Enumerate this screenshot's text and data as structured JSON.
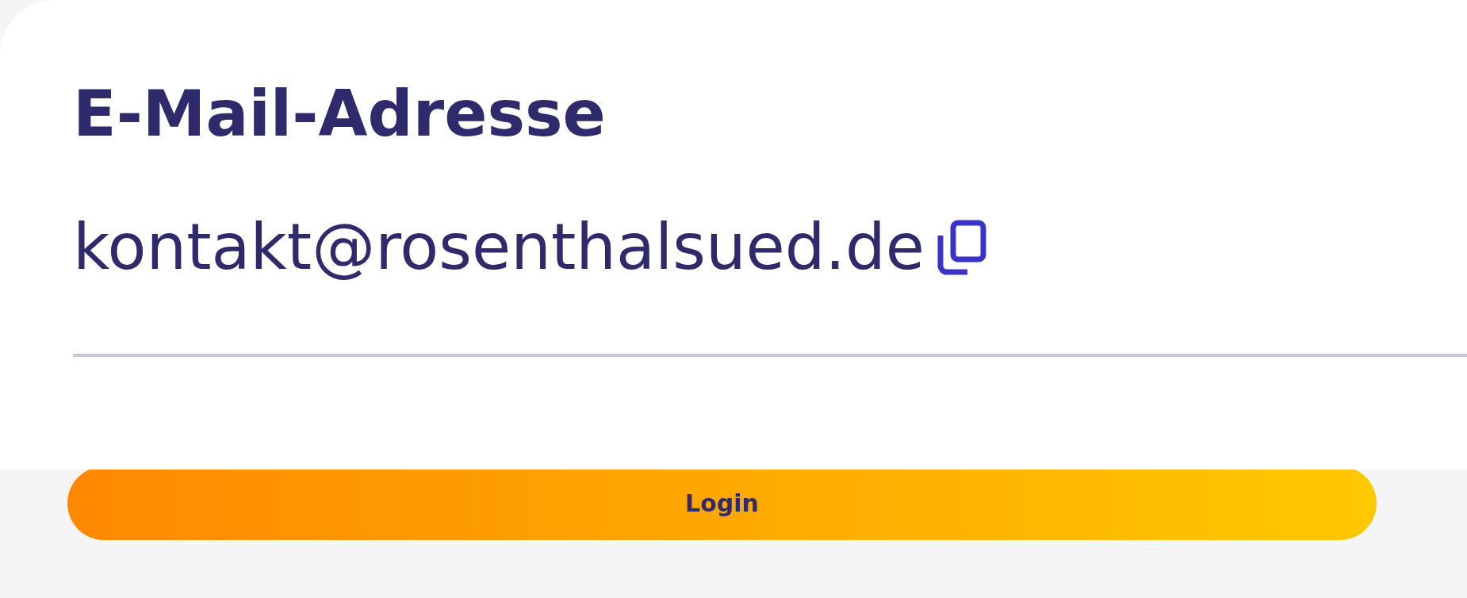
{
  "field": {
    "label": "E-Mail-Adresse",
    "value": "kontakt@rosenthalsued.de"
  },
  "button": {
    "label": "Login"
  }
}
